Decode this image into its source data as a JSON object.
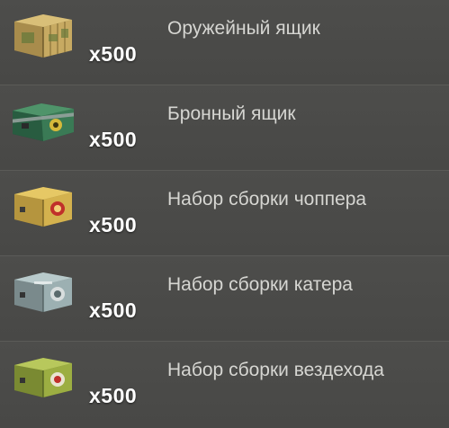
{
  "items": [
    {
      "name": "Оружейный ящик",
      "quantity": "x500",
      "icon": "weapon-crate-icon",
      "color": "#b59a52"
    },
    {
      "name": "Бронный ящик",
      "quantity": "x500",
      "icon": "armor-crate-icon",
      "color": "#2f6b4a"
    },
    {
      "name": "Набор сборки чоппера",
      "quantity": "x500",
      "icon": "chopper-kit-crate-icon",
      "color": "#c9a648"
    },
    {
      "name": "Набор сборки катера",
      "quantity": "x500",
      "icon": "boat-kit-crate-icon",
      "color": "#8fa2a4"
    },
    {
      "name": "Набор сборки вездехода",
      "quantity": "x500",
      "icon": "atv-kit-crate-icon",
      "color": "#9aa848"
    }
  ]
}
